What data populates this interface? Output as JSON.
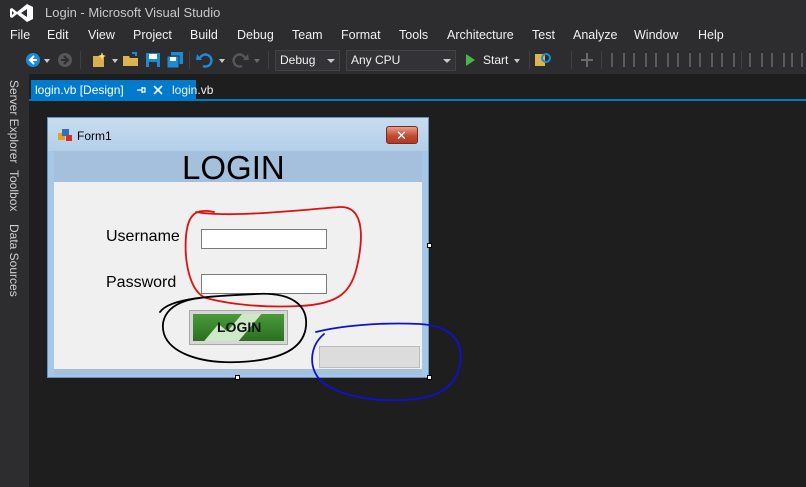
{
  "window": {
    "title": "Login - Microsoft Visual Studio"
  },
  "menu": [
    "File",
    "Edit",
    "View",
    "Project",
    "Build",
    "Debug",
    "Team",
    "Format",
    "Tools",
    "Architecture",
    "Test",
    "Analyze",
    "Window",
    "Help"
  ],
  "toolbar": {
    "configuration": "Debug",
    "platform": "Any CPU",
    "start_label": "Start",
    "icons": [
      "back-icon",
      "forward-icon",
      "new-project-icon",
      "open-file-icon",
      "save-icon",
      "save-all-icon",
      "undo-icon",
      "redo-icon",
      "find-icon",
      "format-align-icons"
    ]
  },
  "side_tabs": [
    "Server Explorer",
    "Toolbox",
    "Data Sources"
  ],
  "document_tabs": [
    {
      "label": "login.vb [Design]",
      "active": true
    },
    {
      "label": "login.vb",
      "active": false
    }
  ],
  "form": {
    "title": "Form1",
    "header": "LOGIN",
    "username_label": "Username",
    "password_label": "Password",
    "username_value": "",
    "password_value": "",
    "login_button_label": "LOGIN"
  },
  "colors": {
    "accent": "#007acc",
    "chrome_bg": "#2d2d30",
    "designer_bg": "#1e1e1e",
    "form_header": "#a4c0dc",
    "annotation_red": "#e01010",
    "annotation_black": "#000000",
    "annotation_blue": "#1010d0"
  }
}
